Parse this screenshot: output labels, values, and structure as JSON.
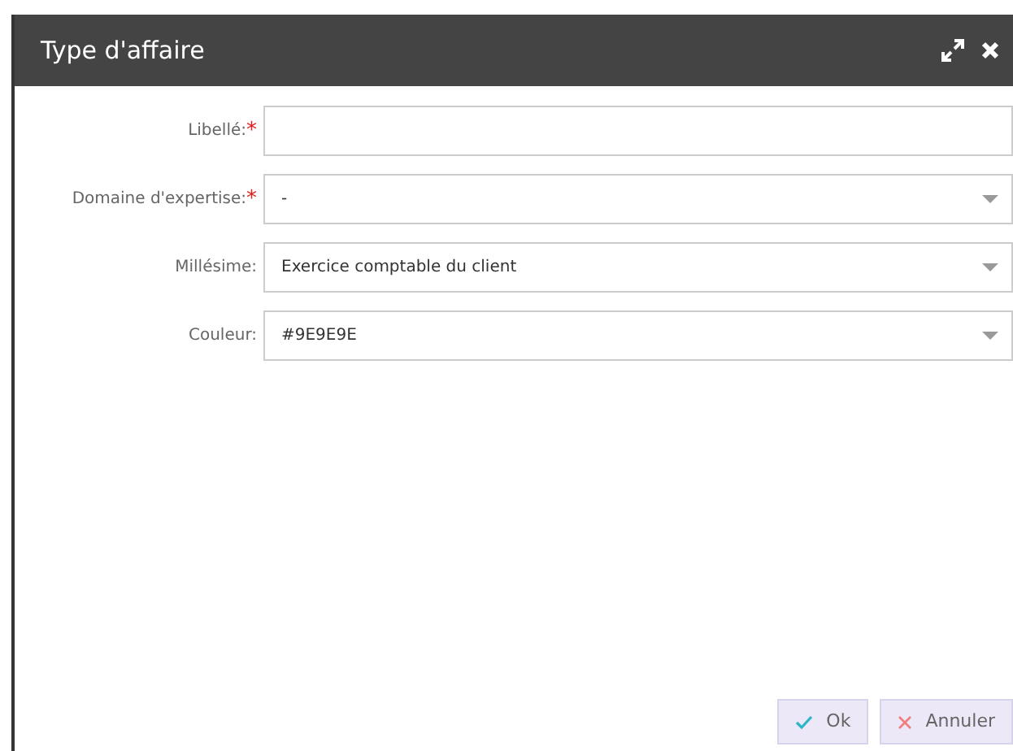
{
  "dialog": {
    "title": "Type d'affaire"
  },
  "fields": [
    {
      "kind": "text",
      "label": "Libellé:",
      "required_mark": "*"
    },
    {
      "kind": "select",
      "label": "Domaine d'expertise:",
      "required_mark": "*",
      "value": "-"
    },
    {
      "kind": "select",
      "label": "Millésime:",
      "value": "Exercice comptable du client"
    },
    {
      "kind": "select",
      "label": "Couleur:",
      "value": "#9E9E9E"
    }
  ],
  "buttons": [
    {
      "kind": "ok",
      "label": "Ok"
    },
    {
      "kind": "cancel",
      "label": "Annuler"
    }
  ]
}
